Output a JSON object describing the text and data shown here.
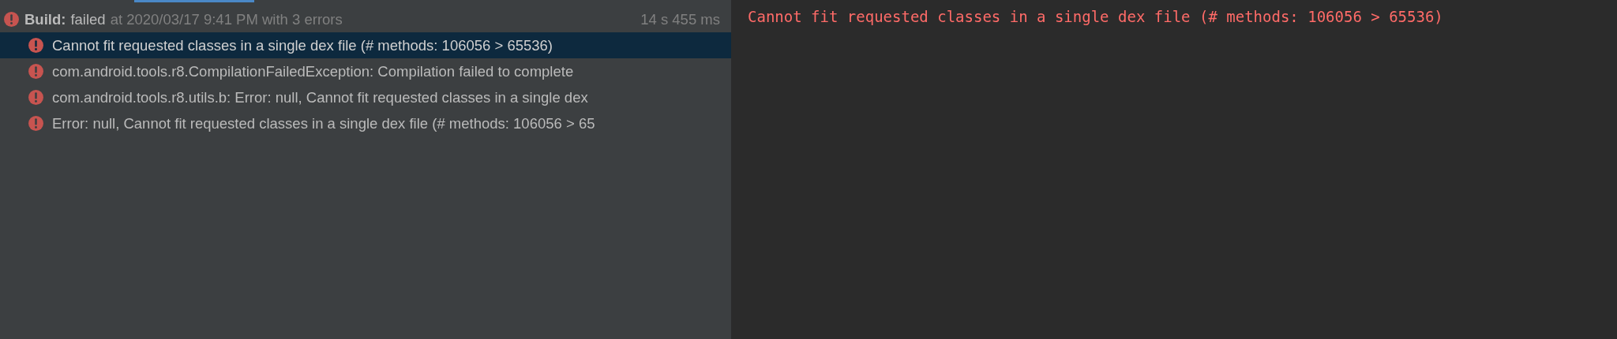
{
  "build": {
    "label": "Build:",
    "status": "failed",
    "detail": "at 2020/03/17 9:41 PM with 3 errors",
    "duration": "14 s 455 ms"
  },
  "messages": [
    {
      "text": "Cannot fit requested classes in a single dex file (# methods: 106056 > 65536)",
      "selected": true
    },
    {
      "text": "com.android.tools.r8.CompilationFailedException: Compilation failed to complete",
      "selected": false
    },
    {
      "text": "com.android.tools.r8.utils.b: Error: null, Cannot fit requested classes in a single dex",
      "selected": false
    },
    {
      "text": "Error: null, Cannot fit requested classes in a single dex file (# methods: 106056 > 65",
      "selected": false
    }
  ],
  "console": {
    "text": "Cannot fit requested classes in a single dex file (# methods: 106056 > 65536)"
  }
}
